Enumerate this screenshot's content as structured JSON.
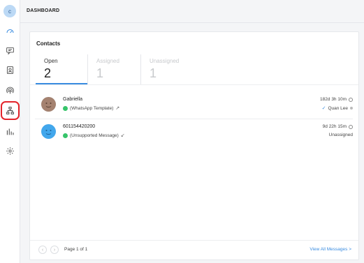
{
  "user": {
    "initial": "c"
  },
  "sidebar": {
    "items": [
      {
        "icon": "speedometer-icon"
      },
      {
        "icon": "chat-icon"
      },
      {
        "icon": "contact-card-icon"
      },
      {
        "icon": "broadcast-icon"
      },
      {
        "icon": "workflow-icon",
        "highlighted": true
      },
      {
        "icon": "bar-chart-icon"
      },
      {
        "icon": "gear-icon"
      }
    ]
  },
  "header": {
    "title": "DASHBOARD"
  },
  "contacts": {
    "title": "Contacts",
    "tabs": [
      {
        "label": "Open",
        "count": "2",
        "active": true
      },
      {
        "label": "Assigned",
        "count": "1",
        "active": false
      },
      {
        "label": "Unassigned",
        "count": "1",
        "active": false
      }
    ],
    "rows": [
      {
        "name": "Gabriella",
        "message": "(WhatsApp Template)",
        "time": "182d 3h 10m",
        "assignee": "Quan Lee",
        "avatar_color": "#9c7b6a"
      },
      {
        "name": "601154420200",
        "message": "(Unsupported Message)",
        "time": "9d 22h 15m",
        "assignee": "Unassigned",
        "avatar_color": "#3fa3e8"
      }
    ],
    "footer": {
      "page_text": "Page 1 of 1",
      "view_all": "View All Messages >"
    }
  },
  "colors": {
    "accent": "#3a8ce0",
    "highlight": "#e3242b",
    "whatsapp": "#36c46a"
  }
}
